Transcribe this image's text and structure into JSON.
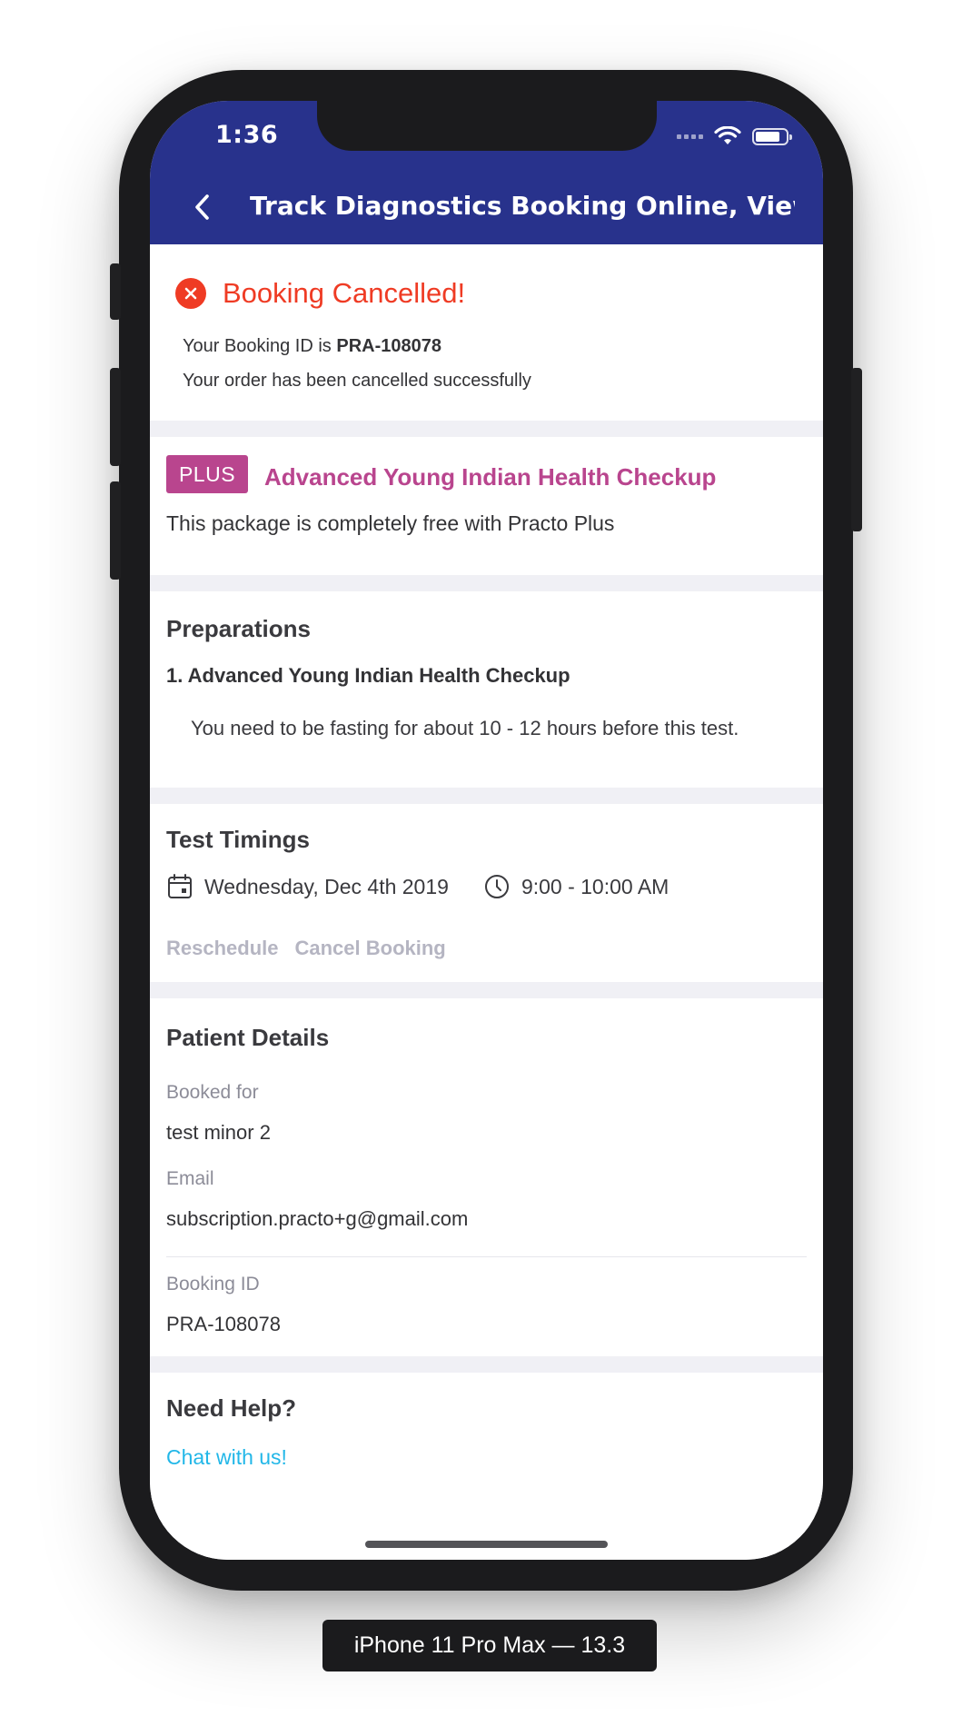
{
  "status_bar": {
    "time": "1:36"
  },
  "nav": {
    "title": "Track Diagnostics Booking Online, View P..."
  },
  "cancellation": {
    "title": "Booking Cancelled!",
    "booking_id_prefix": "Your Booking ID is ",
    "booking_id": "PRA-108078",
    "message": "Your order has been cancelled successfully"
  },
  "plus": {
    "badge": "PLUS",
    "package_name": "Advanced Young Indian Health Checkup",
    "note": "This package is completely free with Practo Plus"
  },
  "preparations": {
    "heading": "Preparations",
    "item_title": "1. Advanced Young Indian Health Checkup",
    "item_text": "You need to be fasting for about 10 - 12 hours before this test."
  },
  "timings": {
    "heading": "Test Timings",
    "date": "Wednesday, Dec 4th 2019",
    "time": "9:00 - 10:00 AM",
    "reschedule": "Reschedule",
    "cancel": "Cancel Booking"
  },
  "patient": {
    "heading": "Patient Details",
    "booked_for_label": "Booked for",
    "booked_for_value": "test minor 2",
    "email_label": "Email",
    "email_value": "subscription.practo+g@gmail.com",
    "booking_id_label": "Booking ID",
    "booking_id_value": "PRA-108078"
  },
  "help": {
    "heading": "Need Help?",
    "chat": "Chat with us!"
  },
  "device_caption": "iPhone 11 Pro Max — 13.3",
  "colors": {
    "header": "#28328c",
    "cancel_red": "#ef3b24",
    "plus_magenta": "#b9458e",
    "link_blue": "#22b7e8",
    "muted_action": "#b5b5c2"
  }
}
